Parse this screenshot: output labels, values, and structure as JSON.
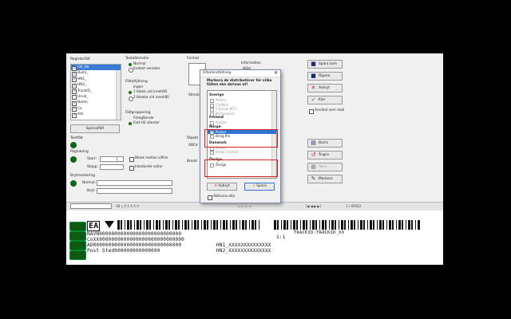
{
  "left": {
    "title": "Registerfält",
    "items": [
      {
        "label": "Lbl_Ha",
        "checked": true,
        "selected": true
      },
      {
        "label": "Buml_",
        "checked": true
      },
      {
        "label": "HN1_",
        "checked": true
      },
      {
        "label": "HN2_",
        "checked": true
      },
      {
        "label": "TrackID_",
        "checked": true
      },
      {
        "label": "Urval_",
        "checked": false
      },
      {
        "label": "Namn",
        "checked": true
      },
      {
        "label": "Co",
        "checked": true
      },
      {
        "label": "Adr",
        "checked": true
      },
      {
        "label": "Postnr",
        "checked": true
      }
    ],
    "special_button": "Specialfält",
    "textfalt_label": "Textfält",
    "paginering_label": "Paginering",
    "start_label": "Start:",
    "start_value": "1",
    "stopp_label": "Stopp:",
    "blank_label": "Blank mellan siffror",
    "inledande_label": "Inledande nollor",
    "brytmarkering_label": "Brytmarkering",
    "normal_label": "Normal:",
    "bryt_label": "Bryt:"
  },
  "mid": {
    "textalternativ": "Textalternativ",
    "normal": "Normal",
    "endast": "Endast versaler",
    "fallutfyllning": "Fältutfyllning",
    "ingen": "Ingen",
    "blank_efter": "1 blank vid innehåll",
    "tva_blank": "2 blanka vid innehåll",
    "faltgruppering": "Fältgruppering",
    "foregaende": "Föregående",
    "fast": "Fast till vänster"
  },
  "bg": {
    "format_label": "Format",
    "information_label": "Information",
    "hojd_label": "Höjd",
    "strecka_label": "Strecka",
    "objekt_label": "Objekt",
    "abcd_label": "ABCd",
    "bredd_label": "Bredd"
  },
  "right": {
    "spara_som": "Spara som",
    "oppna": "Öppna",
    "avbryt": "Avbryt",
    "klar": "Klar",
    "anvand": "Använd som mall",
    "borra": "Borra",
    "angra": "Ångra",
    "skriv": "Skriv",
    "markera": "Markera"
  },
  "toolbar": {
    "page": "1 / 45922"
  },
  "label": {
    "ean": "EA",
    "row1": "NAVN000000000000000000000000000",
    "row2": "CoXX0000000000000000000000000000",
    "row3": "ADR0000000000000000000000000000",
    "row4": "Post Sted000000000000000",
    "hn1": "HN1_XXXXXXXXXXXXXX",
    "hn2": "HN2_XXXXXXXXXXXXXX",
    "count": "1:1",
    "track": "TRACKID:TRACKID_XX"
  },
  "dialog": {
    "title": "Filteminställning",
    "question": "Markera de distributörer för vilka fälten ska skrivas ut!",
    "groups": [
      {
        "name": "Sverige",
        "items": [
          {
            "label": "Posten",
            "on": false
          },
          {
            "label": "CityMail",
            "on": false
          },
          {
            "label": "Citymail MTG",
            "on": false
          },
          {
            "label": "Morgonpost",
            "on": false
          }
        ]
      },
      {
        "name": "Finland",
        "items": [
          {
            "label": "Posten",
            "on": false
          }
        ]
      },
      {
        "name": "Norge",
        "items": [
          {
            "label": "Posten",
            "on": true,
            "checked": true,
            "selected": true
          },
          {
            "label": "Bring Pro",
            "on": true
          }
        ]
      },
      {
        "name": "Danmark",
        "items": [
          {
            "label": "Posten",
            "on": false
          },
          {
            "label": "Bring Citymail",
            "on": false
          }
        ]
      },
      {
        "name": "Övriga",
        "items": [
          {
            "label": "Övriga",
            "on": true
          }
        ]
      }
    ],
    "cancel": "Avbryt",
    "ok": "Spara",
    "aktivera": "Aktivera alla"
  },
  "colors": {
    "accent": "#2e74d0",
    "highlight": "#d42020",
    "green": "#117711"
  }
}
